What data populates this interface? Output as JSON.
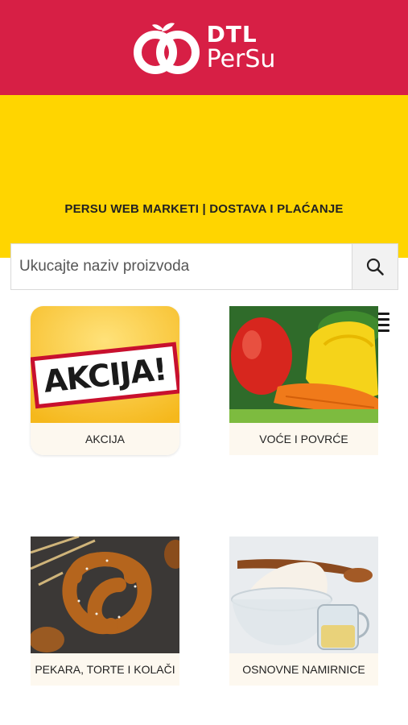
{
  "brand": {
    "line1": "DTL",
    "line2": "PerSu"
  },
  "tagline": "PERSU WEB MARKETI | DOSTAVA I PLAĆANJE",
  "search": {
    "placeholder": "Ukucajte naziv proizvoda",
    "value": ""
  },
  "promo_badge": "AKCIJA!",
  "categories": [
    {
      "label": "AKCIJA"
    },
    {
      "label": "VOĆE I POVRĆE"
    },
    {
      "label": "PEKARA, TORTE I KOLAČI"
    },
    {
      "label": "OSNOVNE NAMIRNICE"
    }
  ],
  "colors": {
    "red": "#d71f45",
    "yellow": "#ffd500",
    "label_bg": "#fdf8ef"
  }
}
